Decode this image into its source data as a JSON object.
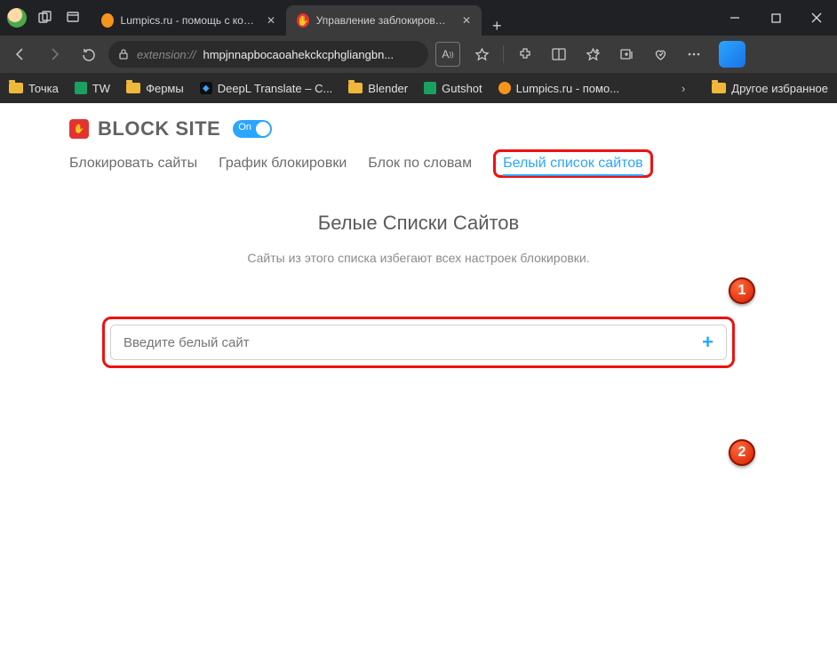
{
  "window": {
    "tabs": [
      {
        "title": "Lumpics.ru - помощь с компьюте",
        "active": false
      },
      {
        "title": "Управление заблокированными",
        "active": true
      }
    ]
  },
  "addressbar": {
    "protocol": "extension://",
    "host": "hmpjnnapbocaoahekckcphgliangbn...",
    "aa_label": "A"
  },
  "bookmarks": {
    "items": [
      {
        "label": "Точка",
        "icon": "folder"
      },
      {
        "label": "TW",
        "icon": "sheet"
      },
      {
        "label": "Фермы",
        "icon": "folder"
      },
      {
        "label": "DeepL Translate – C...",
        "icon": "deepl"
      },
      {
        "label": "Blender",
        "icon": "folder"
      },
      {
        "label": "Gutshot",
        "icon": "sheet"
      },
      {
        "label": "Lumpics.ru - помо...",
        "icon": "oc"
      }
    ],
    "other": "Другое избранное"
  },
  "app": {
    "brand": "BLOCK SITE",
    "toggle_label": "On",
    "nav": {
      "block_sites": "Блокировать сайты",
      "schedule": "График блокировки",
      "block_words": "Блок по словам",
      "whitelist": "Белый список сайтов"
    },
    "title": "Белые Списки Сайтов",
    "subtitle": "Сайты из этого списка избегают всех настроек блокировки.",
    "input_placeholder": "Введите белый сайт"
  },
  "markers": {
    "m1": "1",
    "m2": "2"
  }
}
